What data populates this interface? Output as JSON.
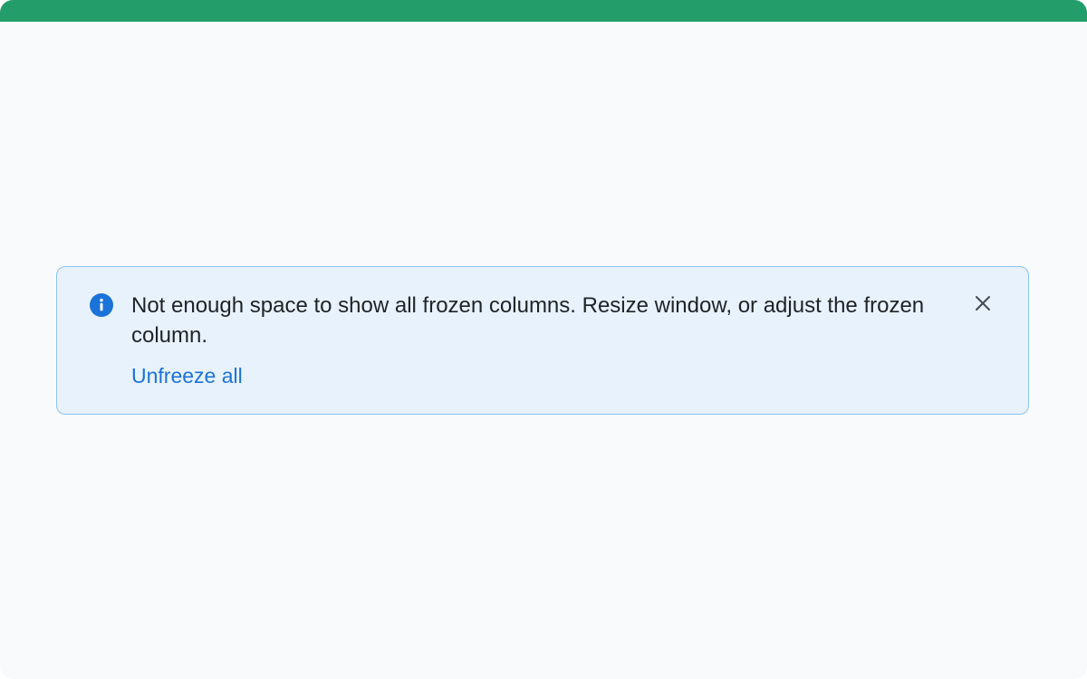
{
  "alert": {
    "type": "info",
    "message": "Not enough space to show all frozen columns. Resize window, or adjust the frozen column.",
    "action_label": "Unfreeze all",
    "close_icon": "close-icon",
    "info_icon": "info-icon"
  },
  "colors": {
    "header_bar": "#239e6b",
    "background": "#f8fafc",
    "alert_background": "#e8f2fc",
    "alert_border": "#8cc3ef",
    "accent": "#1a73d9",
    "text": "#1f2328"
  }
}
